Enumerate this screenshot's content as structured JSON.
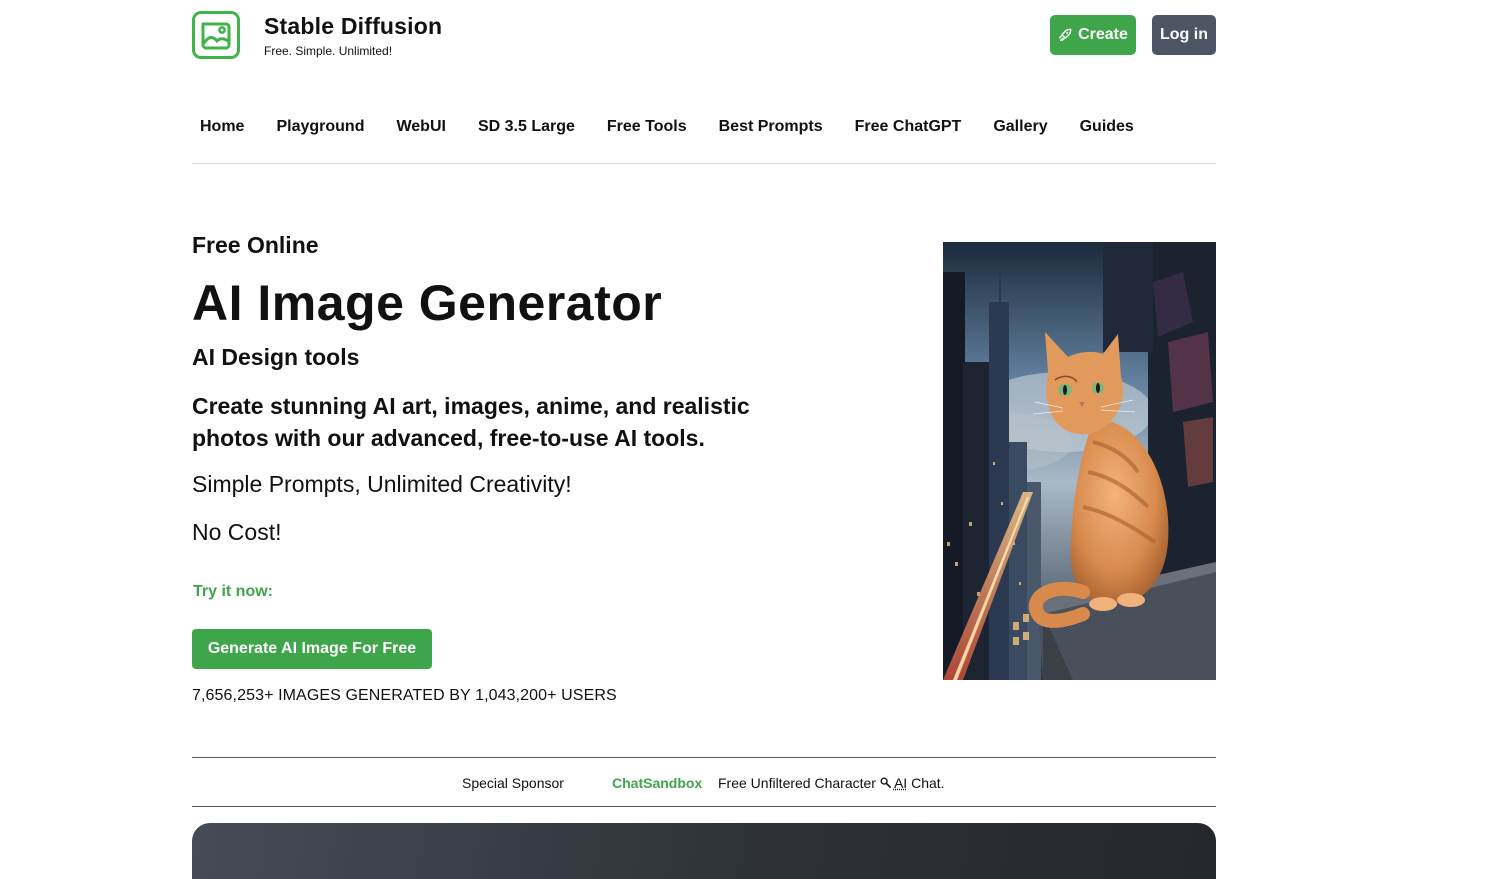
{
  "brand": {
    "title": "Stable Diffusion",
    "tagline": "Free. Simple. Unlimited!",
    "logo_icon": "image-icon",
    "accent_color": "#3fa54a"
  },
  "header": {
    "create_label": "Create",
    "create_icon": "rocket-icon",
    "login_label": "Log in"
  },
  "nav": {
    "items": [
      "Home",
      "Playground",
      "WebUI",
      "SD 3.5 Large",
      "Free Tools",
      "Best Prompts",
      "Free ChatGPT",
      "Gallery",
      "Guides"
    ]
  },
  "hero": {
    "kicker": "Free Online",
    "title": "AI Image Generator",
    "subtitle": "AI Design tools",
    "description": "Create stunning AI art, images, anime, and realistic photos with our advanced, free-to-use AI tools.",
    "line_simple": "Simple Prompts, Unlimited Creativity!",
    "line_cost": "No Cost!",
    "try_label": "Try it now:",
    "cta_label": "Generate AI Image For Free",
    "stats": "7,656,253+ IMAGES GENERATED BY 1,043,200+ USERS"
  },
  "sponsor": {
    "label": "Special Sponsor",
    "name": "ChatSandbox",
    "desc_prefix": "Free Unfiltered Character ",
    "desc_icon": "magnifier-icon",
    "desc_abbr": "AI",
    "desc_suffix": " Chat."
  }
}
